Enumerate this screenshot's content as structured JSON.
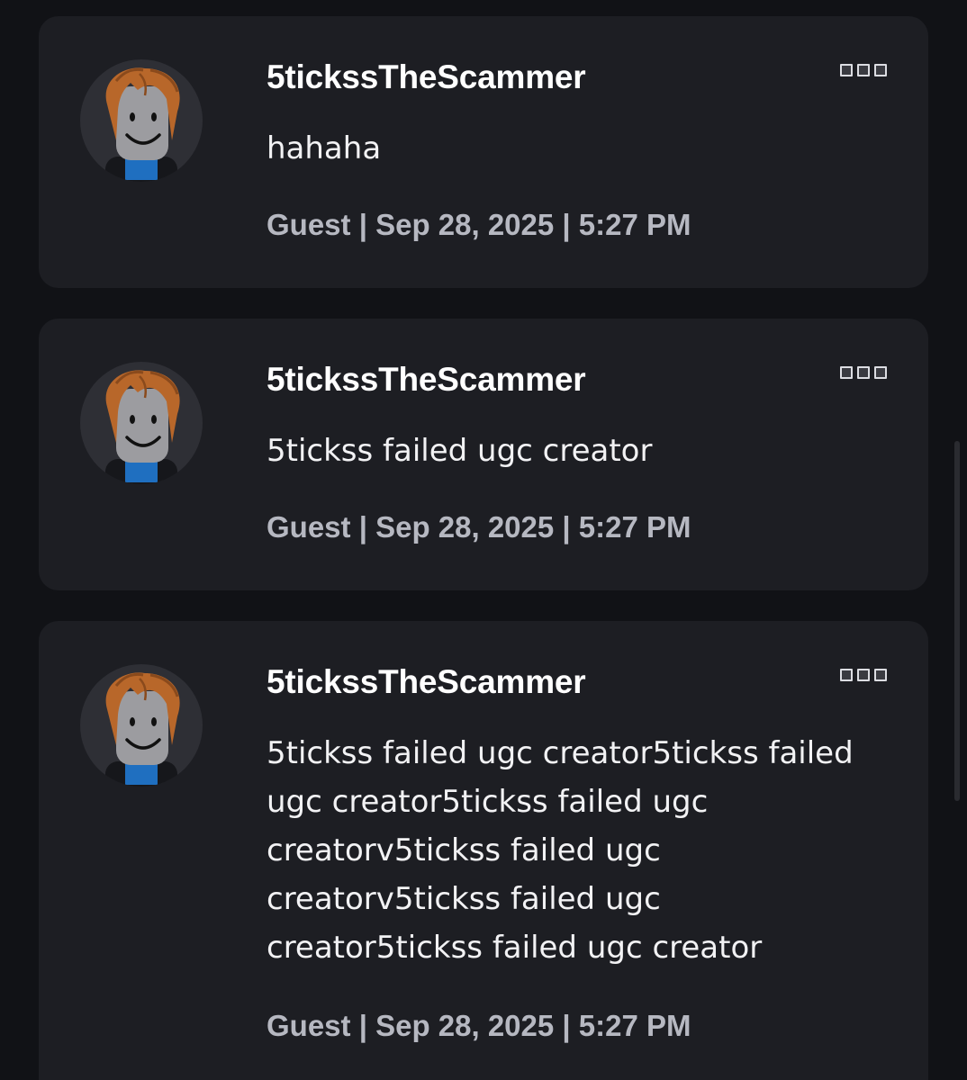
{
  "comments": [
    {
      "username": "5tickssTheScammer",
      "message": "hahaha",
      "meta": "Guest | Sep 28, 2025 | 5:27 PM"
    },
    {
      "username": "5tickssTheScammer",
      "message": "5tickss failed ugc creator",
      "meta": "Guest | Sep 28, 2025 | 5:27 PM"
    },
    {
      "username": "5tickssTheScammer",
      "message": "5tickss failed ugc creator5tickss failed ugc creator5tickss failed ugc creatorv5tickss failed ugc creatorv5tickss failed ugc creator5tickss failed ugc creator",
      "meta": "Guest | Sep 28, 2025 | 5:27 PM"
    }
  ],
  "icons": {
    "avatar": "avatar-icon",
    "more": "more-options-icon"
  },
  "colors": {
    "background": "#111216",
    "card": "#1d1e23",
    "meta_text": "#b6b8c1",
    "hair": "#b8672a",
    "shirt": "#1f6fc0"
  }
}
